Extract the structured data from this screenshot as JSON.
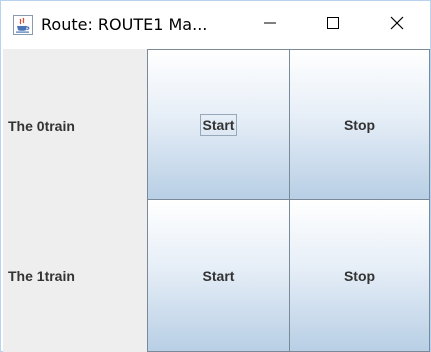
{
  "window": {
    "title": "Route: ROUTE1 Ma...",
    "icon": "java-coffee-cup-icon",
    "controls": {
      "minimize": "minimize-icon",
      "maximize": "maximize-icon",
      "close": "close-icon"
    }
  },
  "trains": [
    {
      "label": "The 0train",
      "start_label": "Start",
      "stop_label": "Stop"
    },
    {
      "label": "The 1train",
      "start_label": "Start",
      "stop_label": "Stop"
    }
  ],
  "colors": {
    "button_top": "#ffffff",
    "button_bottom": "#b8cfe5",
    "button_border": "#7a8a99",
    "panel_bg": "#eeeeee",
    "text": "#333333"
  }
}
